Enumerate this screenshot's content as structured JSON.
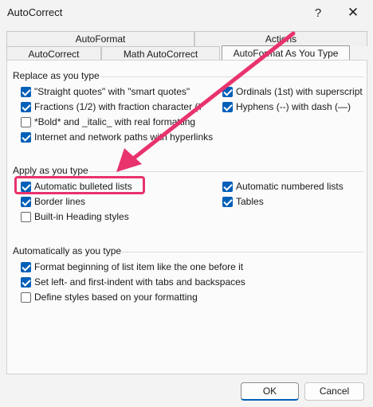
{
  "window": {
    "title": "AutoCorrect",
    "help_glyph": "?",
    "close_glyph": "✕"
  },
  "tabs": {
    "back_row": [
      "AutoFormat",
      "Actions"
    ],
    "front_row": [
      "AutoCorrect",
      "Math AutoCorrect",
      "AutoFormat As You Type"
    ],
    "active": "AutoFormat As You Type"
  },
  "sections": {
    "replace": {
      "title": "Replace as you type",
      "left": [
        {
          "label": "\"Straight quotes\" with \"smart quotes\"",
          "checked": true
        },
        {
          "label": "Fractions (1/2) with fraction character (½",
          "checked": true
        },
        {
          "label": "*Bold* and _italic_ with real formatting",
          "checked": false
        },
        {
          "label": "Internet and network paths with hyperlinks",
          "checked": true
        }
      ],
      "right": [
        {
          "label": "Ordinals (1st) with superscript",
          "checked": true
        },
        {
          "label": "Hyphens (--) with dash (—)",
          "checked": true
        }
      ]
    },
    "apply": {
      "title": "Apply as you type",
      "left": [
        {
          "label": "Automatic bulleted lists",
          "checked": true
        },
        {
          "label": "Border lines",
          "checked": true
        },
        {
          "label": "Built-in Heading styles",
          "checked": false
        }
      ],
      "right": [
        {
          "label": "Automatic numbered lists",
          "checked": true
        },
        {
          "label": "Tables",
          "checked": true
        }
      ]
    },
    "auto": {
      "title": "Automatically as you type",
      "items": [
        {
          "label": "Format beginning of list item like the one before it",
          "checked": true
        },
        {
          "label": "Set left- and first-indent with tabs and backspaces",
          "checked": true
        },
        {
          "label": "Define styles based on your formatting",
          "checked": false
        }
      ]
    }
  },
  "buttons": {
    "ok": "OK",
    "cancel": "Cancel"
  },
  "annotation": {
    "color": "#e8336d",
    "highlighted_item": "Automatic bulleted lists"
  }
}
